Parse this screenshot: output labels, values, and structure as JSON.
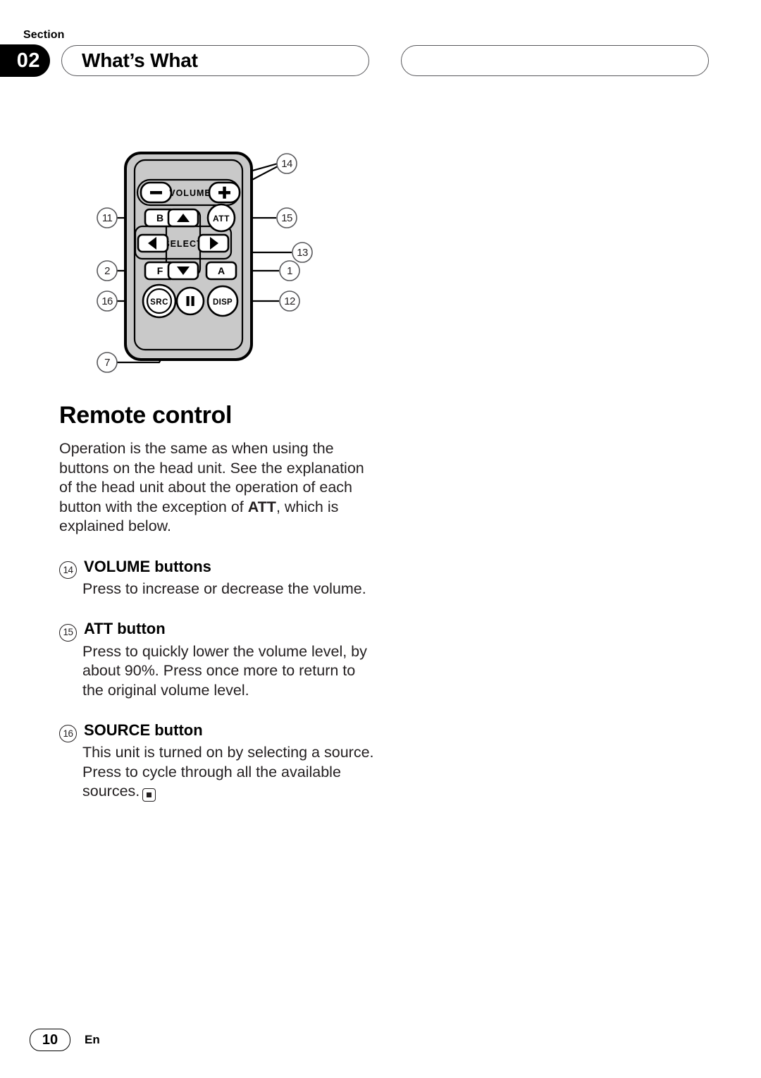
{
  "header": {
    "section_label": "Section",
    "section_number": "02",
    "title": "What’s What",
    "right_pill_title": ""
  },
  "figure": {
    "name": "remote-control-diagram",
    "buttons": {
      "volume_label": "VOLUME",
      "volume_minus": "–",
      "volume_plus": "+",
      "b": "B",
      "f": "F",
      "a": "A",
      "att": "ATT",
      "src": "SRC",
      "disp": "DISP",
      "select": "SELECT",
      "up": "▲",
      "down": "▼",
      "left": "◀",
      "right": "▶",
      "pause": "❚❚"
    },
    "callouts": {
      "left": [
        "11",
        "2",
        "16",
        "7"
      ],
      "right": [
        "14",
        "15",
        "13",
        "1",
        "12"
      ]
    },
    "colors": {
      "body": "#c9c9c9",
      "outline": "#000000",
      "button_face": "#ffffff"
    }
  },
  "main": {
    "heading": "Remote control",
    "intro": "Operation is the same as when using the buttons on the head unit. See the explanation of the head unit about the operation of each button with the exception of ",
    "intro_bold": "ATT",
    "intro_tail": ", which is explained below.",
    "items": [
      {
        "num": "14",
        "title": "VOLUME buttons",
        "body": "Press to increase or decrease the volume.",
        "end_mark": false
      },
      {
        "num": "15",
        "title": "ATT button",
        "body": "Press to quickly lower the volume level, by about 90%. Press once more to return to the original volume level.",
        "end_mark": false
      },
      {
        "num": "16",
        "title": "SOURCE button",
        "body": "This unit is turned on by selecting a source. Press to cycle through all the available sources.",
        "end_mark": true
      }
    ]
  },
  "footer": {
    "page_number": "10",
    "language": "En"
  }
}
